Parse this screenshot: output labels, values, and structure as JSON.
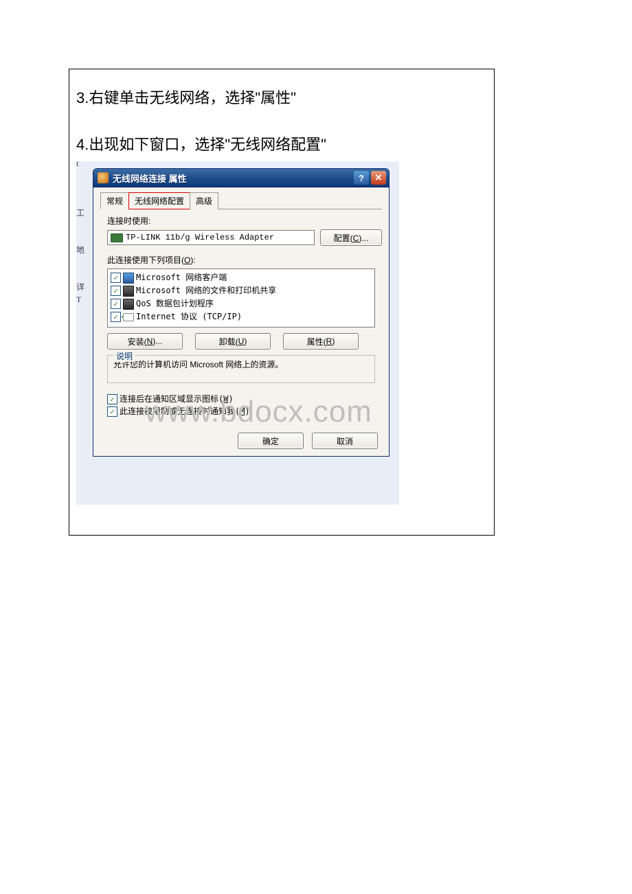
{
  "steps": {
    "step3": "3.右键单击无线网络，选择\"属性\"",
    "step4": "4.出现如下窗口，选择\"无线网络配置\""
  },
  "dialog": {
    "title": "无线网络连接 属性",
    "help_label": "?",
    "close_label": "✕",
    "tabs": {
      "general": "常规",
      "wireless": "无线网络配置",
      "advanced": "高级"
    },
    "connect_using_label": "连接时使用:",
    "adapter_name": "TP-LINK 11b/g Wireless Adapter",
    "configure_btn": "配置(C)...",
    "items_label": "此连接使用下列项目(O):",
    "items": [
      {
        "label": "Microsoft 网络客户端",
        "icon": "proto-monitor",
        "checked": true
      },
      {
        "label": "Microsoft 网络的文件和打印机共享",
        "icon": "proto-share",
        "checked": true
      },
      {
        "label": "QoS 数据包计划程序",
        "icon": "proto-qos",
        "checked": true
      },
      {
        "label": "Internet 协议 (TCP/IP)",
        "icon": "proto-tcpip",
        "checked": true
      }
    ],
    "install_btn": "安装(N)...",
    "uninstall_btn": "卸载(U)",
    "properties_btn": "属性(R)",
    "desc_legend": "说明",
    "desc_text": "允许您的计算机访问 Microsoft 网络上的资源。",
    "show_icon_label": "连接后在通知区域显示图标(W)",
    "notify_label": "此连接被限制或无连接时通知我(M)",
    "ok_btn": "确定",
    "cancel_btn": "取消"
  },
  "watermark": "www.bdocx.com"
}
